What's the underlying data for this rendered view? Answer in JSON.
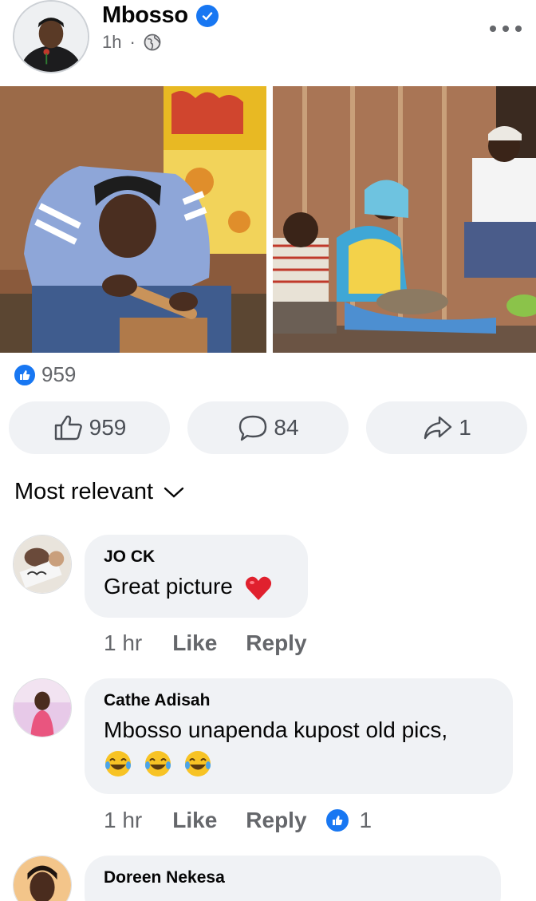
{
  "post": {
    "author": "Mbosso",
    "time": "1h",
    "dot": "·",
    "reaction_count": "959"
  },
  "actions": {
    "like_count": "959",
    "comment_count": "84",
    "share_count": "1"
  },
  "sort_label": "Most relevant",
  "comments": [
    {
      "name": "JO CK",
      "text": "Great picture",
      "time": "1 hr",
      "like": "Like",
      "reply": "Reply"
    },
    {
      "name": "Cathe Adisah",
      "text": "Mbosso unapenda kupost old pics,",
      "time": "1 hr",
      "like": "Like",
      "reply": "Reply",
      "reactions": "1"
    },
    {
      "name": "Doreen Nekesa"
    }
  ],
  "colors": {
    "accent": "#1877f2",
    "muted": "#65676b",
    "bubble": "#f0f2f5"
  },
  "icons": [
    "verified-icon",
    "globe-icon",
    "more-icon",
    "like-icon",
    "comment-icon",
    "share-icon",
    "chevron-down-icon",
    "heart-emoji",
    "laugh-emoji"
  ]
}
